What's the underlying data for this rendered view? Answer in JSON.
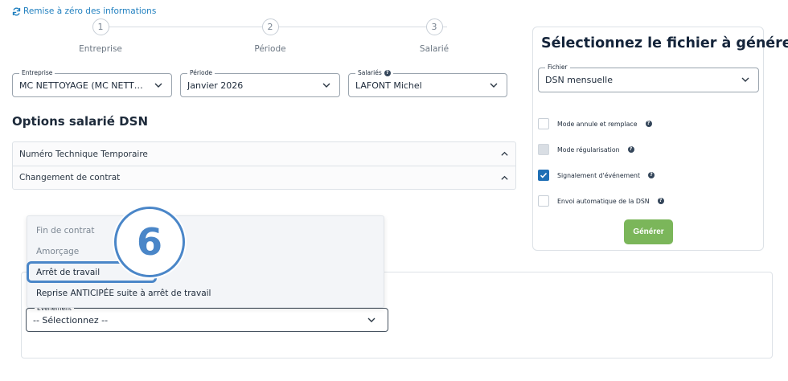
{
  "reset": {
    "label": "Remise à zéro des informations"
  },
  "stepper": {
    "steps": [
      {
        "number": "1",
        "label": "Entreprise"
      },
      {
        "number": "2",
        "label": "Période"
      },
      {
        "number": "3",
        "label": "Salarié"
      }
    ]
  },
  "filters": {
    "entreprise": {
      "label": "Entreprise",
      "value": "MC NETTOYAGE (MC NETTOYAGE)"
    },
    "periode": {
      "label": "Période",
      "value": "Janvier 2026"
    },
    "salaries": {
      "label": "Salariés",
      "value": "LAFONT Michel"
    }
  },
  "options": {
    "title": "Options salarié DSN",
    "rows": [
      {
        "label": "Numéro Technique Temporaire"
      },
      {
        "label": "Changement de contrat"
      }
    ]
  },
  "event": {
    "label": "Evénement",
    "value": "-- Sélectionnez --",
    "options": [
      {
        "label": "Fin de contrat",
        "disabled": true
      },
      {
        "label": "Amorçage",
        "disabled": true
      },
      {
        "label": "Arrêt de travail",
        "disabled": false,
        "highlighted": true
      },
      {
        "label": "Reprise ANTICIPÉE suite à arrêt de travail",
        "disabled": false
      }
    ]
  },
  "callout": {
    "number": "6"
  },
  "file_panel": {
    "title": "Sélectionnez le fichier à générer",
    "file_select": {
      "label": "Fichier",
      "value": "DSN mensuelle"
    },
    "checkboxes": [
      {
        "label": "Mode annule et remplace",
        "checked": false,
        "disabled": false
      },
      {
        "label": "Mode régularisation",
        "checked": false,
        "disabled": true
      },
      {
        "label": "Signalement d'événement",
        "checked": true,
        "disabled": false
      },
      {
        "label": "Envoi automatique de la DSN",
        "checked": false,
        "disabled": false
      }
    ],
    "generate_label": "Générer"
  },
  "colors": {
    "accent": "#1f7fbf",
    "callout": "#4a86c8",
    "generate": "#7bb65a",
    "checked": "#1f6fb5"
  }
}
